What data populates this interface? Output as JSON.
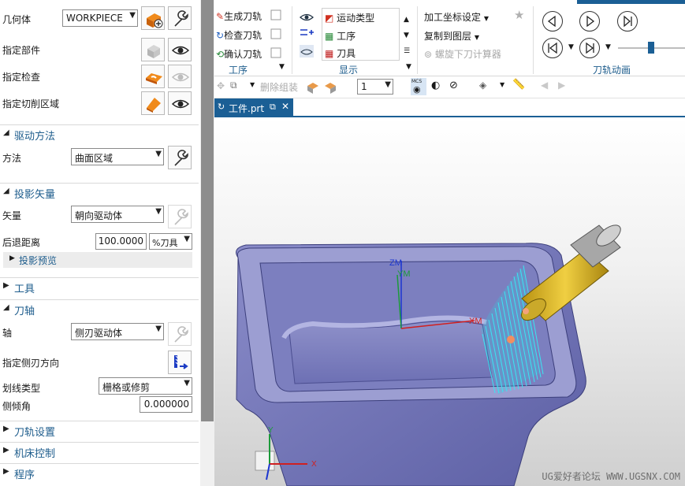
{
  "dialog": {
    "geometry": {
      "label": "几何体",
      "value": "WORKPIECE"
    },
    "specify_part": "指定部件",
    "specify_check": "指定检查",
    "specify_cut_area": "指定切削区域",
    "drive_method": {
      "title": "驱动方法",
      "method_label": "方法",
      "method_value": "曲面区域"
    },
    "projection_vector": {
      "title": "投影矢量",
      "vector_label": "矢量",
      "vector_value": "朝向驱动体",
      "retract_label": "后退距离",
      "retract_value": "100.0000",
      "retract_unit": "%刀具",
      "preview_label": "投影预览"
    },
    "tool": {
      "title": "工具"
    },
    "tool_axis": {
      "title": "刀轴",
      "axis_label": "轴",
      "axis_value": "侧刃驱动体",
      "side_dir_label": "指定侧刃方向",
      "pattern_label": "划线类型",
      "pattern_value": "栅格或修剪",
      "tilt_label": "侧倾角",
      "tilt_value": "0.000000"
    },
    "path_settings": {
      "title": "刀轨设置"
    },
    "machine_control": {
      "title": "机床控制"
    },
    "program": {
      "title": "程序"
    }
  },
  "ribbon": {
    "operation": {
      "generate": "生成刀轨",
      "verify": "检查刀轨",
      "confirm": "确认刀轨",
      "group": "工序"
    },
    "display": {
      "motion_type": "运动类型",
      "operation": "工序",
      "tool": "刀具",
      "group": "显示"
    },
    "mcs_set": "加工坐标设定",
    "copy_layer": "复制到图层",
    "helix_calc": "螺旋下刀计算器",
    "animation_group": "刀轨动画"
  },
  "toolbar2": {
    "delete_group": "删除组装",
    "count_value": "1",
    "mcs_label": "MCS"
  },
  "tab": {
    "label": "工件.prt"
  },
  "viewport": {
    "axis_zm": "ZM",
    "axis_ym": "YM",
    "axis_xm": "XM",
    "axis_x": "X",
    "axis_y": "Y",
    "watermark": "UG爱好者论坛 WWW.UGSNX.COM"
  },
  "colors": {
    "section_title": "#1d5c8c",
    "accent_blue": "#1b5f95",
    "part_body": "#6f72b8",
    "toolpath": "#39e6f2",
    "tool_holder": "#d7b21f"
  }
}
